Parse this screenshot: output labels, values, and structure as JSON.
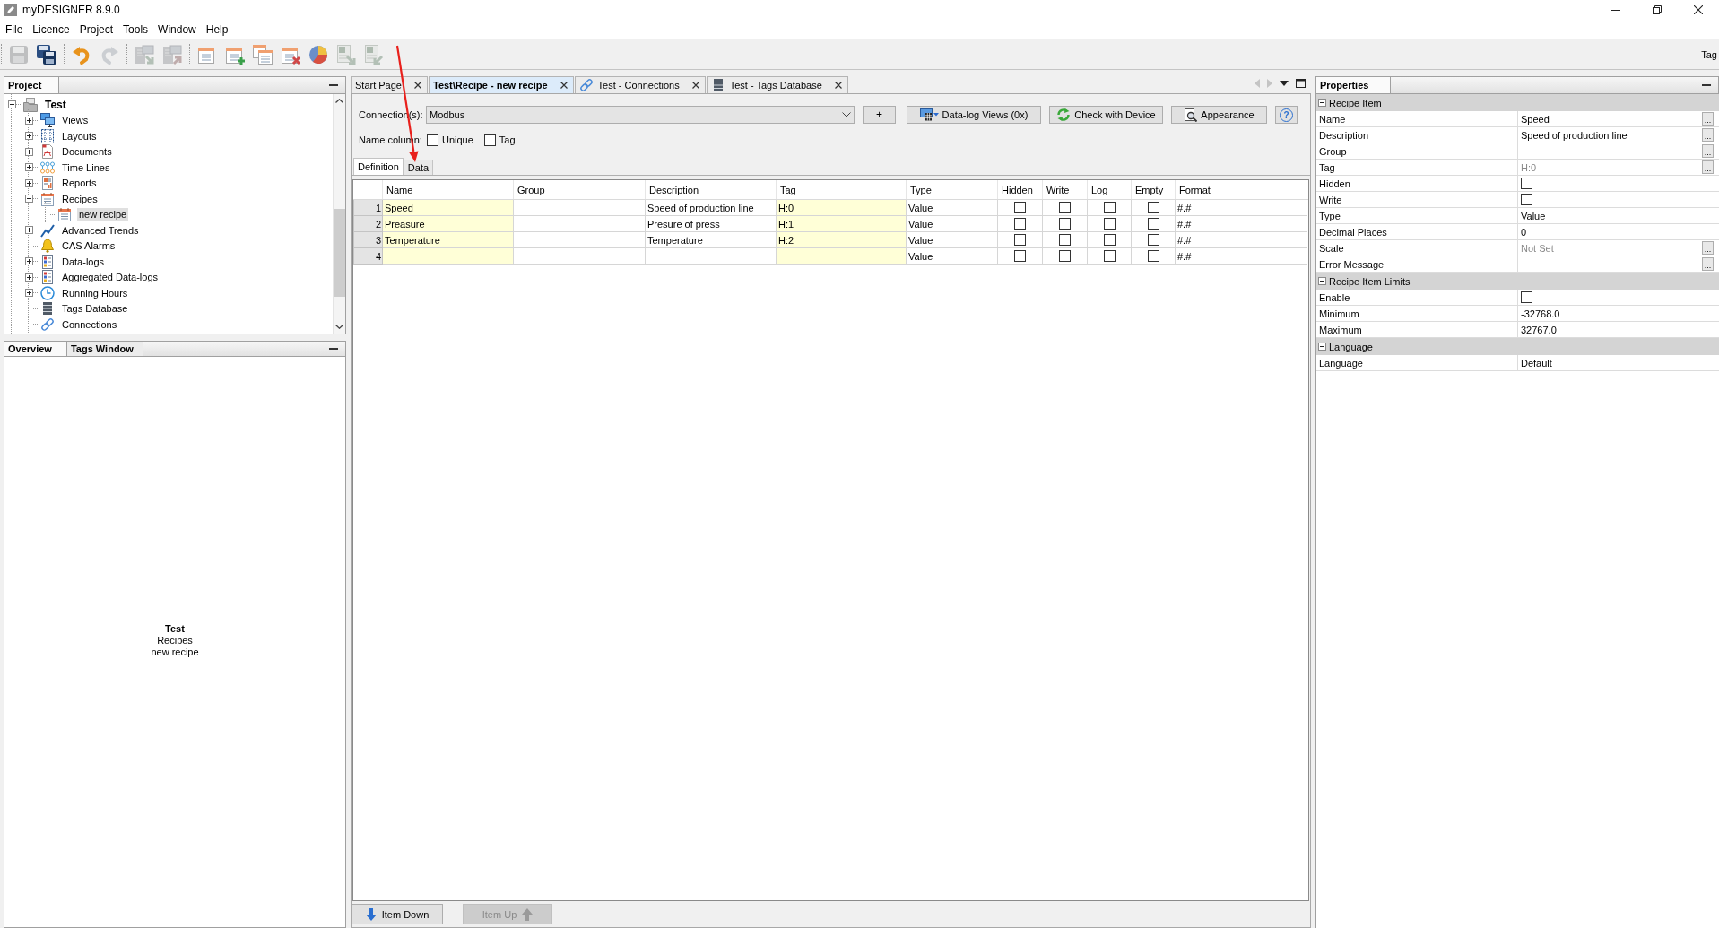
{
  "window": {
    "title": "myDESIGNER 8.9.0"
  },
  "menu": [
    "File",
    "Licence",
    "Project",
    "Tools",
    "Window",
    "Help"
  ],
  "toolbar": {
    "groups": [
      [
        {
          "kind": "save",
          "disabled": true
        },
        {
          "kind": "saveall",
          "disabled": false
        }
      ],
      [
        {
          "kind": "undo",
          "disabled": false
        },
        {
          "kind": "redo",
          "disabled": true
        }
      ],
      [
        {
          "kind": "import",
          "disabled": true
        },
        {
          "kind": "export",
          "disabled": true
        }
      ],
      [
        {
          "kind": "calendar",
          "disabled": false
        },
        {
          "kind": "calendaradd",
          "disabled": false
        },
        {
          "kind": "calendarcopy",
          "disabled": false
        },
        {
          "kind": "calendardelete",
          "disabled": false
        },
        {
          "kind": "pie",
          "disabled": false
        },
        {
          "kind": "sheetexport",
          "disabled": true
        },
        {
          "kind": "sheetimport",
          "disabled": true
        }
      ]
    ],
    "trailing_label": "Tag"
  },
  "project": {
    "title": "Project",
    "tree": [
      {
        "label": "Test",
        "kind": "project",
        "expanded": true,
        "selected": false,
        "children": [
          {
            "label": "Views",
            "kind": "monitor",
            "expanded": false,
            "selected": false
          },
          {
            "label": "Layouts",
            "kind": "layout",
            "expanded": false,
            "selected": false
          },
          {
            "label": "Documents",
            "kind": "document",
            "expanded": false,
            "selected": false
          },
          {
            "label": "Time Lines",
            "kind": "timeline",
            "expanded": false,
            "selected": false
          },
          {
            "label": "Reports",
            "kind": "report",
            "expanded": false,
            "selected": false
          },
          {
            "label": "Recipes",
            "kind": "calendar",
            "expanded": true,
            "selected": false,
            "children": [
              {
                "label": "new recipe",
                "kind": "calendar",
                "selected": true
              }
            ]
          },
          {
            "label": "Advanced Trends",
            "kind": "trend",
            "expanded": false,
            "selected": false
          },
          {
            "label": "CAS Alarms",
            "kind": "bell",
            "selected": false
          },
          {
            "label": "Data-logs",
            "kind": "list",
            "expanded": false,
            "selected": false
          },
          {
            "label": "Aggregated Data-logs",
            "kind": "list",
            "expanded": false,
            "selected": false
          },
          {
            "label": "Running Hours",
            "kind": "clock",
            "expanded": false,
            "selected": false
          },
          {
            "label": "Tags Database",
            "kind": "database",
            "selected": false
          },
          {
            "label": "Connections",
            "kind": "link",
            "selected": false
          }
        ]
      }
    ]
  },
  "overview": {
    "tabs": [
      {
        "label": "Overview",
        "selected": true
      },
      {
        "label": "Tags Window",
        "selected": false
      }
    ],
    "lines": [
      "Test",
      "Recipes",
      "new recipe"
    ]
  },
  "editor": {
    "tabs": [
      {
        "label": "Start Page",
        "kind": "plain",
        "selected": false
      },
      {
        "label": "Test\\Recipe - new recipe",
        "kind": "plain",
        "selected": true
      },
      {
        "label": "Test - Connections",
        "kind": "link",
        "selected": false
      },
      {
        "label": "Test - Tags Database",
        "kind": "database",
        "selected": false
      }
    ],
    "connection": {
      "label": "Connection(s):",
      "value": "Modbus"
    },
    "actions": [
      {
        "kind": "plus",
        "label": "+"
      },
      {
        "kind": "datalog",
        "label": "Data-log Views (0x)"
      },
      {
        "kind": "check",
        "label": "Check with Device"
      },
      {
        "kind": "appearance",
        "label": "Appearance"
      },
      {
        "kind": "help",
        "label": "?"
      }
    ],
    "name_column": {
      "label": "Name column:",
      "options": [
        {
          "label": "Unique",
          "checked": false
        },
        {
          "label": "Tag",
          "checked": false
        }
      ]
    },
    "subtabs": [
      {
        "label": "Definition",
        "selected": true
      },
      {
        "label": "Data",
        "selected": false
      }
    ],
    "table": {
      "columns": [
        {
          "label": "Name",
          "kind": "text",
          "highlight": true
        },
        {
          "label": "Group",
          "kind": "text",
          "highlight": false
        },
        {
          "label": "Description",
          "kind": "text",
          "highlight": false
        },
        {
          "label": "Tag",
          "kind": "text",
          "highlight": true
        },
        {
          "label": "Type",
          "kind": "text",
          "highlight": false
        },
        {
          "label": "Hidden",
          "kind": "check",
          "highlight": false
        },
        {
          "label": "Write",
          "kind": "check",
          "highlight": false
        },
        {
          "label": "Log",
          "kind": "check",
          "highlight": false
        },
        {
          "label": "Empty",
          "kind": "check",
          "highlight": false
        },
        {
          "label": "Format",
          "kind": "text",
          "highlight": false
        }
      ],
      "rows": [
        {
          "number": "1",
          "name": "Speed",
          "description": "Speed of production line",
          "tag": "H:0",
          "type": "Value",
          "hidden": false,
          "write": false,
          "log": false,
          "empty": false,
          "format": "#.#"
        },
        {
          "number": "2",
          "name": "Preasure",
          "description": "Presure of press",
          "tag": "H:1",
          "type": "Value",
          "hidden": false,
          "write": false,
          "log": false,
          "empty": false,
          "format": "#.#"
        },
        {
          "number": "3",
          "name": "Temperature",
          "description": "Temperature",
          "tag": "H:2",
          "type": "Value",
          "hidden": false,
          "write": false,
          "log": false,
          "empty": false,
          "format": "#.#"
        },
        {
          "number": "4",
          "type": "Value",
          "hidden": false,
          "write": false,
          "log": false,
          "empty": false,
          "format": "#.#"
        }
      ]
    },
    "footer_buttons": [
      {
        "label": "Item Down",
        "kind": "down",
        "disabled": false
      },
      {
        "label": "Item Up",
        "kind": "up",
        "disabled": true
      }
    ]
  },
  "properties": {
    "title": "Properties",
    "sections": [
      {
        "title": "Recipe Item",
        "expanded": true,
        "rows": [
          {
            "label": "Name",
            "kind": "text",
            "value": "Speed",
            "button": "..."
          },
          {
            "label": "Description",
            "kind": "text",
            "value": "Speed of production line",
            "button": "..."
          },
          {
            "label": "Group",
            "kind": "text",
            "button": "..."
          },
          {
            "label": "Tag",
            "kind": "readonly",
            "value": "H:0",
            "button": "..."
          },
          {
            "label": "Hidden",
            "kind": "check",
            "checked": false
          },
          {
            "label": "Write",
            "kind": "check",
            "checked": false
          },
          {
            "label": "Type",
            "kind": "text",
            "value": "Value"
          },
          {
            "label": "Decimal Places",
            "kind": "text",
            "value": "0"
          },
          {
            "label": "Scale",
            "kind": "readonly",
            "value": "Not Set",
            "button": "..."
          },
          {
            "label": "Error Message",
            "kind": "text",
            "button": "..."
          }
        ]
      },
      {
        "title": "Recipe Item Limits",
        "expanded": true,
        "rows": [
          {
            "label": "Enable",
            "kind": "check",
            "checked": false
          },
          {
            "label": "Minimum",
            "kind": "text",
            "value": "-32768.0"
          },
          {
            "label": "Maximum",
            "kind": "text",
            "value": "32767.0"
          }
        ]
      },
      {
        "title": "Language",
        "expanded": true,
        "rows": [
          {
            "label": "Language",
            "kind": "text",
            "value": "Default"
          }
        ]
      }
    ]
  }
}
